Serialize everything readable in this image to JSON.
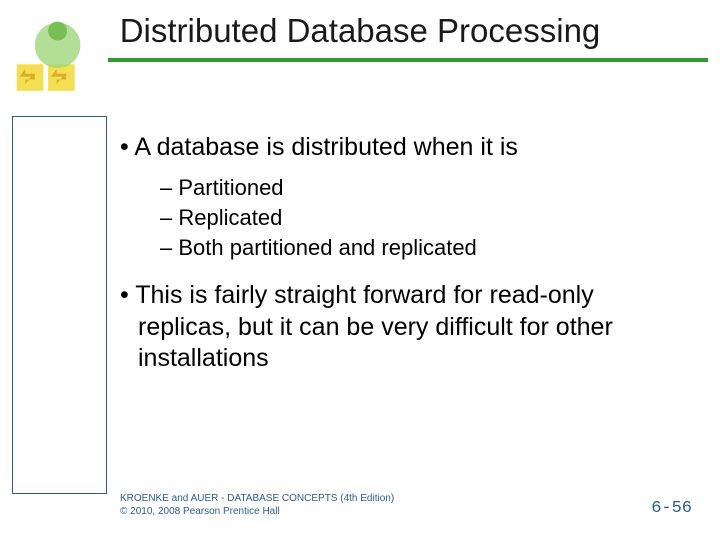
{
  "title": "Distributed Database Processing",
  "bullets": {
    "b1": "A database is distributed when it is",
    "b1_subs": {
      "s1": "Partitioned",
      "s2": "Replicated",
      "s3": "Both partitioned and replicated"
    },
    "b2": "This is fairly straight forward for read-only replicas, but it can be very difficult for other installations"
  },
  "footer": {
    "line1": "KROENKE and AUER - DATABASE CONCEPTS (4th Edition)",
    "line2": "© 2010, 2008 Pearson Prentice Hall",
    "page": "6-56"
  }
}
